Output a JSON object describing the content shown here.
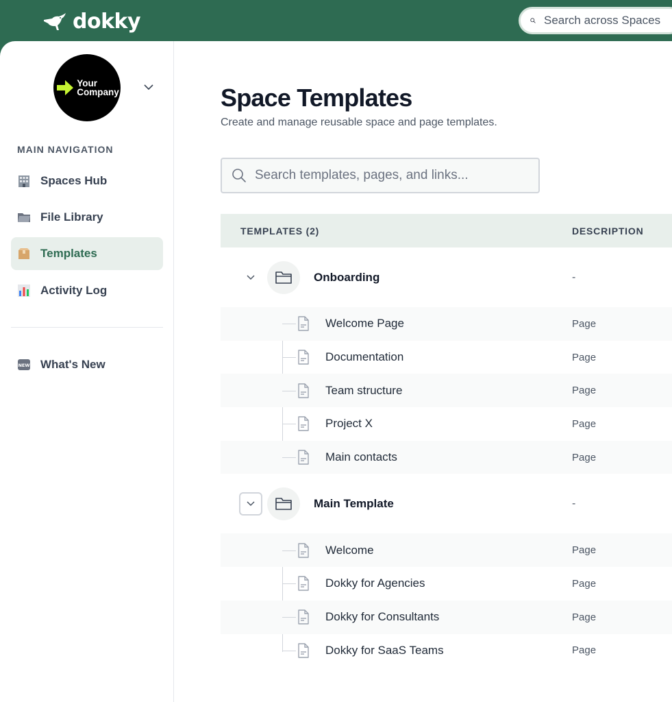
{
  "app": {
    "name": "dokky"
  },
  "global_search": {
    "placeholder": "Search across Spaces"
  },
  "company": {
    "line1": "Your",
    "line2": "Company"
  },
  "sidebar": {
    "heading": "MAIN NAVIGATION",
    "items": [
      {
        "label": "Spaces Hub",
        "icon": "office-building-icon",
        "active": false
      },
      {
        "label": "File Library",
        "icon": "folder-icon",
        "active": false
      },
      {
        "label": "Templates",
        "icon": "box-icon",
        "active": true
      },
      {
        "label": "Activity Log",
        "icon": "bar-chart-icon",
        "active": false
      }
    ],
    "secondary": [
      {
        "label": "What's New",
        "icon": "new-badge-icon"
      }
    ]
  },
  "main": {
    "title": "Space Templates",
    "subtitle": "Create and manage reusable space and page templates.",
    "search_placeholder": "Search templates, pages, and links...",
    "table": {
      "col_templates": "TEMPLATES (2)",
      "col_description": "DESCRIPTION",
      "groups": [
        {
          "name": "Onboarding",
          "description": "-",
          "children": [
            {
              "name": "Welcome Page",
              "type": "Page"
            },
            {
              "name": "Documentation",
              "type": "Page"
            },
            {
              "name": "Team structure",
              "type": "Page"
            },
            {
              "name": "Project X",
              "type": "Page"
            },
            {
              "name": "Main contacts",
              "type": "Page"
            }
          ]
        },
        {
          "name": "Main Template",
          "description": "-",
          "children": [
            {
              "name": "Welcome",
              "type": "Page"
            },
            {
              "name": "Dokky for Agencies",
              "type": "Page"
            },
            {
              "name": "Dokky for Consultants",
              "type": "Page"
            },
            {
              "name": "Dokky for SaaS Teams",
              "type": "Page"
            }
          ]
        }
      ]
    }
  },
  "colors": {
    "brand": "#2e6b52",
    "active_bg": "#e8efeb",
    "accent": "#c6f432"
  }
}
